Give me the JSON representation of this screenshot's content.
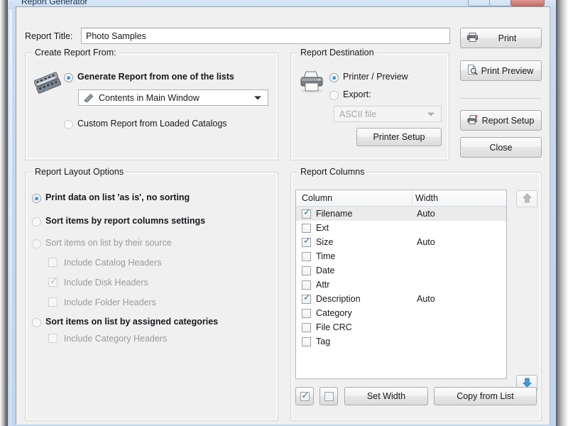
{
  "window": {
    "title": "Report Generator",
    "buttons": {
      "minimize": "minimize-button",
      "maximize": "maximize-button",
      "close": "close-button"
    }
  },
  "report_title": {
    "label": "Report Title:",
    "value": "Photo Samples",
    "placeholder": ""
  },
  "create_report_from": {
    "legend": "Create Report From:",
    "icon": "film-strip-icon",
    "options": [
      {
        "label": "Generate Report from one of the lists",
        "selected": true
      },
      {
        "label": "Custom Report from Loaded Catalogs",
        "selected": false
      }
    ],
    "list_combo": {
      "value": "Contents in Main Window",
      "icon": "list-icon",
      "enabled": true
    }
  },
  "report_destination": {
    "legend": "Report Destination",
    "icon": "printer-icon",
    "options": [
      {
        "label": "Printer / Preview",
        "selected": true
      },
      {
        "label": "Export:",
        "selected": false
      }
    ],
    "export_format": {
      "value": "ASCII file",
      "enabled": false
    },
    "printer_setup_button": "Printer Setup"
  },
  "action_buttons": [
    {
      "label": "Print",
      "icon": "printer-icon"
    },
    {
      "label": "Print Preview",
      "icon": "print-preview-icon"
    },
    {
      "label": "Report Setup",
      "icon": "report-setup-icon"
    },
    {
      "label": "Close",
      "icon": ""
    }
  ],
  "report_layout_options": {
    "legend": "Report Layout Options",
    "radios": [
      {
        "label": "Print data on list 'as is', no sorting",
        "selected": true,
        "enabled": true
      },
      {
        "label": "Sort items by report columns settings",
        "selected": false,
        "enabled": true
      },
      {
        "label": "Sort items on list by their source",
        "selected": false,
        "enabled": false
      },
      {
        "label": "Sort items on list by assigned categories",
        "selected": false,
        "enabled": true
      }
    ],
    "source_checkboxes": [
      {
        "label": "Include Catalog Headers",
        "checked": false,
        "enabled": false
      },
      {
        "label": "Include Disk Headers",
        "checked": true,
        "enabled": false
      },
      {
        "label": "Include Folder Headers",
        "checked": false,
        "enabled": false
      }
    ],
    "category_checkboxes": [
      {
        "label": "Include Category Headers",
        "checked": false,
        "enabled": false
      }
    ]
  },
  "report_columns": {
    "legend": "Report Columns",
    "headers": {
      "column": "Column",
      "width": "Width"
    },
    "rows": [
      {
        "name": "Filename",
        "checked": true,
        "width": "Auto",
        "selected": true
      },
      {
        "name": "Ext",
        "checked": false,
        "width": "",
        "selected": false
      },
      {
        "name": "Size",
        "checked": true,
        "width": "Auto",
        "selected": false
      },
      {
        "name": "Time",
        "checked": false,
        "width": "",
        "selected": false
      },
      {
        "name": "Date",
        "checked": false,
        "width": "",
        "selected": false
      },
      {
        "name": "Attr",
        "checked": false,
        "width": "",
        "selected": false
      },
      {
        "name": "Description",
        "checked": true,
        "width": "Auto",
        "selected": false
      },
      {
        "name": "Category",
        "checked": false,
        "width": "",
        "selected": false
      },
      {
        "name": "File CRC",
        "checked": false,
        "width": "",
        "selected": false
      },
      {
        "name": "Tag",
        "checked": false,
        "width": "",
        "selected": false
      }
    ],
    "move_up_button": {
      "icon": "arrow-up-icon",
      "enabled": false
    },
    "move_down_button": {
      "icon": "arrow-down-icon",
      "enabled": true
    },
    "check_all_button": {
      "icon": "checkbox-checked-icon"
    },
    "uncheck_all_button": {
      "icon": "checkbox-empty-icon"
    },
    "set_width_button": "Set Width",
    "copy_from_list_button": "Copy from List"
  },
  "colors": {
    "accent_blue": "#1775c4",
    "frame_blue": "#c3d8ef",
    "dialog_bg": "#f0f0f0",
    "close_red": "#c96f66",
    "selected_row": "#ebebeb",
    "disabled_text": "#9a9a9a"
  }
}
